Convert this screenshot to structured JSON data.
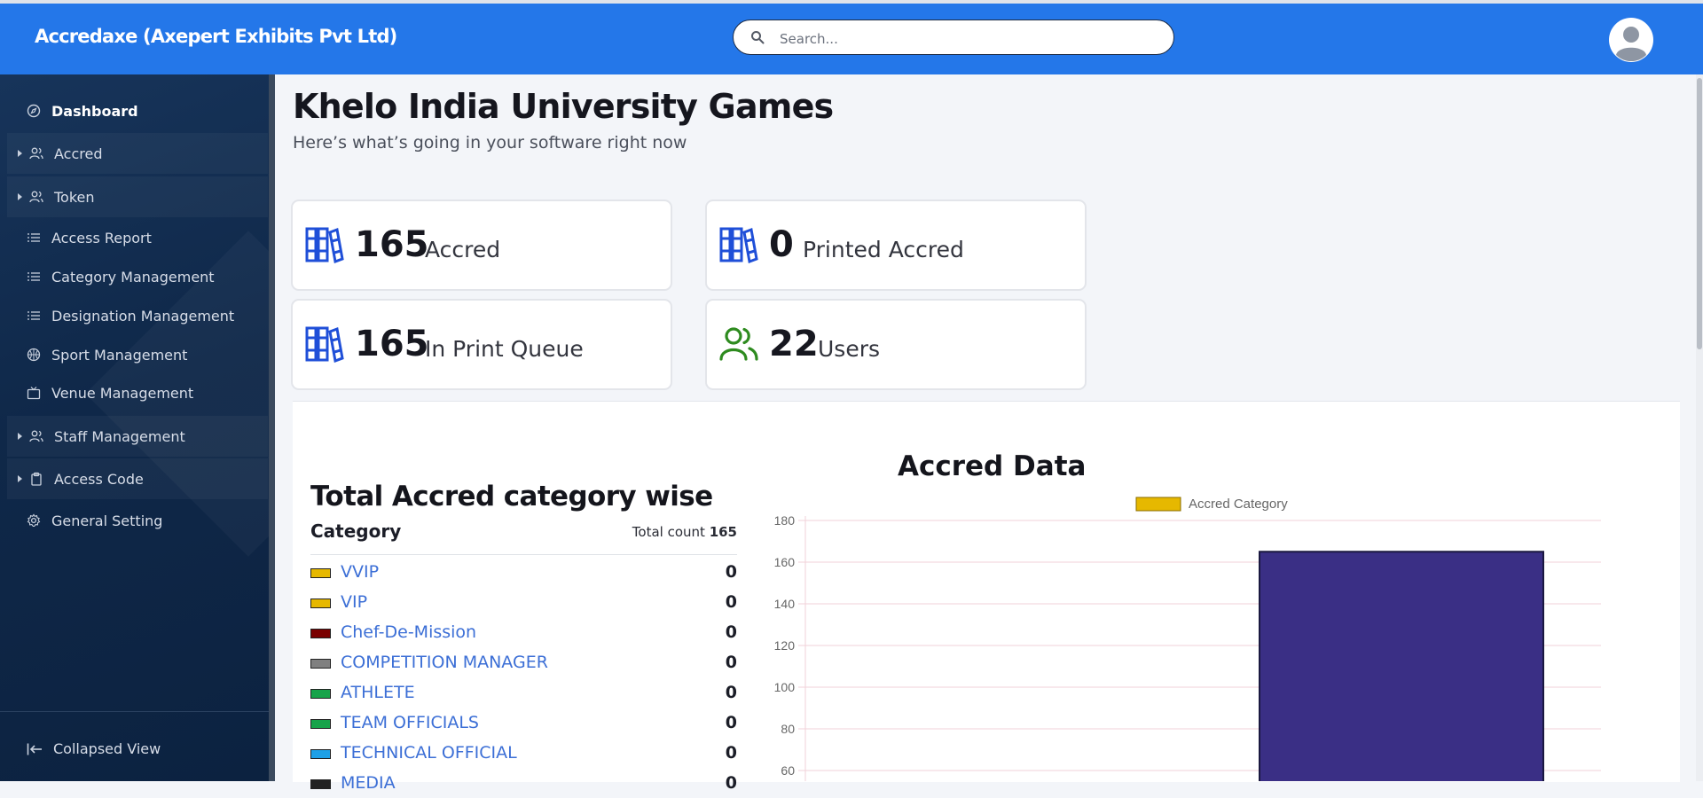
{
  "header": {
    "brand": "Accredaxe (Axepert Exhibits Pvt Ltd)",
    "search_placeholder": "Search..."
  },
  "sidebar": {
    "items": [
      {
        "label": "Dashboard",
        "icon": "compass-icon",
        "active": true
      },
      {
        "label": "Accred",
        "icon": "users-icon",
        "expandable": true
      },
      {
        "label": "Token",
        "icon": "users-icon",
        "expandable": true
      },
      {
        "label": "Access Report",
        "icon": "list-icon"
      },
      {
        "label": "Category Management",
        "icon": "list-icon"
      },
      {
        "label": "Designation Management",
        "icon": "list-icon"
      },
      {
        "label": "Sport Management",
        "icon": "ball-icon"
      },
      {
        "label": "Venue Management",
        "icon": "tv-icon"
      },
      {
        "label": "Staff Management",
        "icon": "users-icon",
        "expandable": true
      },
      {
        "label": "Access Code",
        "icon": "clipboard-icon",
        "expandable": true
      },
      {
        "label": "General Setting",
        "icon": "gear-icon"
      }
    ],
    "collapse_label": "Collapsed View"
  },
  "main": {
    "title": "Khelo India University Games",
    "subtitle": "Here’s what’s going in your software right now",
    "stats": [
      {
        "value": "165",
        "label": "Accred",
        "icon": "books-icon",
        "color": "#1f4fd8"
      },
      {
        "value": "0",
        "label": "Printed Accred",
        "icon": "books-icon",
        "color": "#1f4fd8"
      },
      {
        "value": "165",
        "label": "In Print Queue",
        "icon": "books-icon",
        "color": "#1f4fd8"
      },
      {
        "value": "22",
        "label": "Users",
        "icon": "users-icon",
        "color": "#2e8b1f"
      }
    ],
    "category_section": {
      "title": "Total Accred category wise",
      "column_label": "Category",
      "total_label": "Total count",
      "total_value": "165",
      "rows": [
        {
          "name": "VVIP",
          "count": "0",
          "color": "#e6b800"
        },
        {
          "name": "VIP",
          "count": "0",
          "color": "#e6b800"
        },
        {
          "name": "Chef-De-Mission",
          "count": "0",
          "color": "#7a0000"
        },
        {
          "name": "COMPETITION MANAGER",
          "count": "0",
          "color": "#808080"
        },
        {
          "name": "ATHLETE",
          "count": "0",
          "color": "#17a34a"
        },
        {
          "name": "TEAM OFFICIALS",
          "count": "0",
          "color": "#17a34a"
        },
        {
          "name": "TECHNICAL OFFICIAL",
          "count": "0",
          "color": "#1ea0e6"
        },
        {
          "name": "MEDIA",
          "count": "0",
          "color": "#222222"
        }
      ]
    }
  },
  "chart_data": {
    "type": "bar",
    "title": "Accred Data",
    "legend": "Accred Category",
    "legend_color": "#e6b800",
    "legend_position": "top",
    "grid": true,
    "ylim": [
      60,
      180
    ],
    "yticks": [
      "180",
      "160",
      "140",
      "120",
      "100",
      "80",
      "60"
    ],
    "bar_value": 165,
    "bar_color": "#3a2f85"
  }
}
